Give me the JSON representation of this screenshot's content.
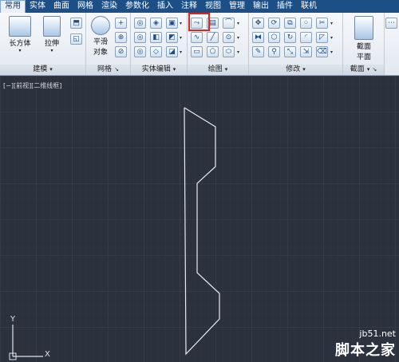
{
  "tabs": [
    "常用",
    "实体",
    "曲面",
    "网格",
    "渲染",
    "参数化",
    "插入",
    "注释",
    "视图",
    "管理",
    "输出",
    "插件",
    "联机"
  ],
  "active_tab": "常用",
  "panels": {
    "modeling": {
      "title": "建模",
      "box_label": "长方体",
      "extrude_label": "拉伸"
    },
    "mesh": {
      "title": "网格",
      "smooth_label_1": "平滑",
      "smooth_label_2": "对象"
    },
    "solid_edit": {
      "title": "实体编辑"
    },
    "draw": {
      "title": "绘图"
    },
    "modify": {
      "title": "修改"
    },
    "section": {
      "title": "截面",
      "plane_label_1": "截面",
      "plane_label_2": "平面"
    }
  },
  "viewport_label": "[−][前视][二维线框]",
  "axis": {
    "y": "Y",
    "x": "X"
  },
  "watermark": {
    "site": "jb51.net",
    "name": "脚本之家"
  },
  "colors": {
    "tabbar": "#1c4f86",
    "canvas": "#2b313d",
    "grid": "#3a4250",
    "highlight": "#e0241a"
  }
}
